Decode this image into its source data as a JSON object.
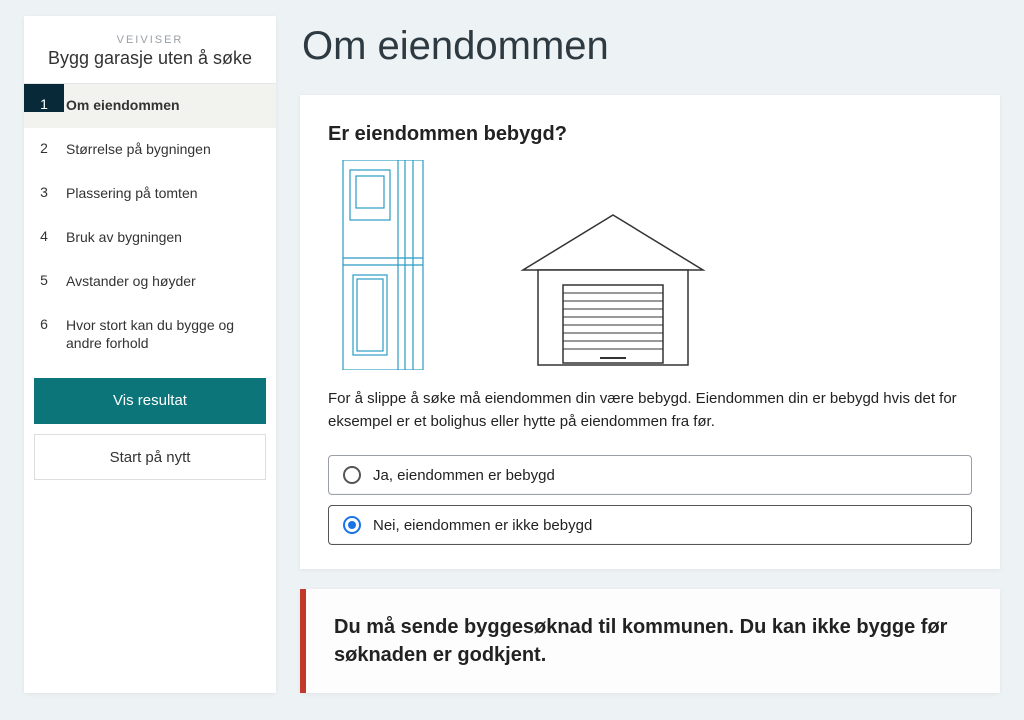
{
  "sidebar": {
    "kicker": "VEIVISER",
    "title": "Bygg garasje uten å søke",
    "steps": [
      {
        "num": "1",
        "label": "Om eiendommen",
        "active": true
      },
      {
        "num": "2",
        "label": "Størrelse på bygningen",
        "active": false
      },
      {
        "num": "3",
        "label": "Plassering på tomten",
        "active": false
      },
      {
        "num": "4",
        "label": "Bruk av bygningen",
        "active": false
      },
      {
        "num": "5",
        "label": "Avstander og høyder",
        "active": false
      },
      {
        "num": "6",
        "label": "Hvor stort kan du bygge og andre forhold",
        "active": false
      }
    ],
    "result_button": "Vis resultat",
    "restart_button": "Start på nytt"
  },
  "main": {
    "page_title": "Om eiendommen",
    "question_title": "Er eiendommen bebygd?",
    "question_text": "For å slippe å søke må eiendommen din være bebygd. Eiendommen din er bebygd hvis det for eksempel er et bolighus eller hytte på eiendommen fra før.",
    "options": [
      {
        "label": "Ja, eiendommen er bebygd",
        "selected": false
      },
      {
        "label": "Nei, eiendommen er ikke bebygd",
        "selected": true
      }
    ],
    "result_text": "Du må sende byggesøknad til kommunen. Du kan ikke bygge før søknaden er godkjent."
  }
}
